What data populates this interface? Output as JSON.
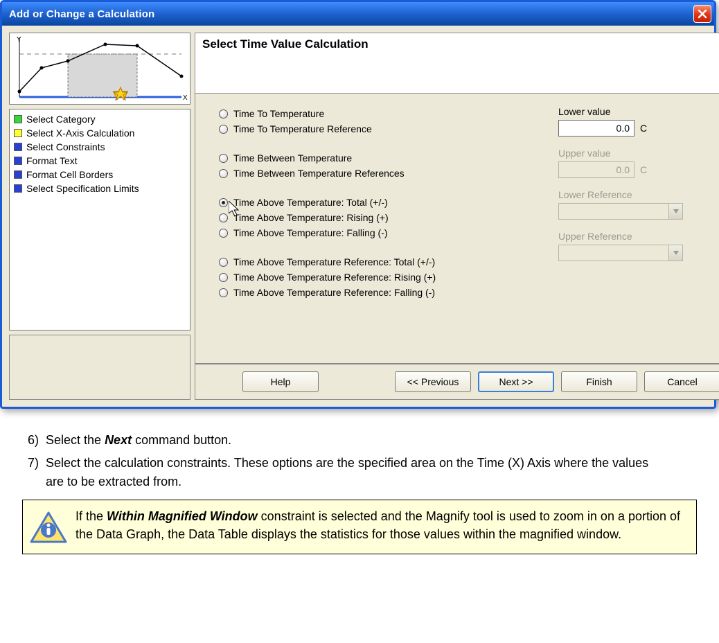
{
  "window": {
    "title": "Add or Change a Calculation"
  },
  "steps": [
    {
      "color": "#39d639",
      "label": "Select Category"
    },
    {
      "color": "#ffff33",
      "label": "Select X-Axis Calculation"
    },
    {
      "color": "#2a3fd4",
      "label": "Select Constraints"
    },
    {
      "color": "#2a3fd4",
      "label": "Format Text"
    },
    {
      "color": "#2a3fd4",
      "label": "Format Cell Borders"
    },
    {
      "color": "#2a3fd4",
      "label": "Select Specification Limits"
    }
  ],
  "panel_heading": "Select Time Value Calculation",
  "radio_groups": [
    [
      "Time To Temperature",
      "Time To Temperature Reference"
    ],
    [
      "Time Between Temperature",
      "Time Between Temperature References"
    ],
    [
      "Time Above Temperature: Total (+/-)",
      "Time Above Temperature: Rising (+)",
      "Time Above Temperature: Falling (-)"
    ],
    [
      "Time Above Temperature Reference: Total (+/-)",
      "Time Above Temperature Reference: Rising (+)",
      "Time Above Temperature Reference: Falling (-)"
    ]
  ],
  "selected_radio": "Time Above Temperature: Total (+/-)",
  "fields": {
    "lower_value": {
      "label": "Lower value",
      "value": "0.0",
      "unit": "C",
      "disabled": false
    },
    "upper_value": {
      "label": "Upper value",
      "value": "0.0",
      "unit": "C",
      "disabled": true
    },
    "lower_ref": {
      "label": "Lower Reference",
      "disabled": true
    },
    "upper_ref": {
      "label": "Upper Reference",
      "disabled": true
    }
  },
  "buttons": {
    "help": "Help",
    "previous": "<< Previous",
    "next": "Next >>",
    "finish": "Finish",
    "cancel": "Cancel"
  },
  "doc": {
    "items": [
      {
        "num": "6)",
        "html": "Select the <b><i>Next</i></b> command button."
      },
      {
        "num": "7)",
        "html": "Select the calculation constraints. These options are the specified area on the Time (X) Axis where the values are to be extracted from."
      }
    ],
    "note_html": "If the <b><i>Within Magnified Window</i></b> constraint is selected and the Magnify tool is used to zoom in on a portion of the Data Graph, the Data Table displays the statistics for those values within the magnified window."
  }
}
